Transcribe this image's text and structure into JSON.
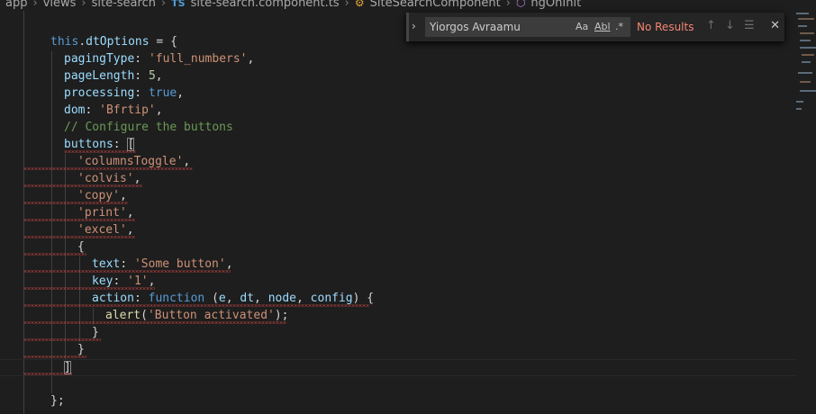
{
  "breadcrumb": {
    "items": [
      "app",
      "views",
      "site-search",
      "site-search.component.ts",
      "SiteSearchComponent",
      "ngOnInit"
    ],
    "ts_badge": "TS"
  },
  "find": {
    "query": "Yiorgos Avraamu",
    "match_case_label": "Aa",
    "whole_word_label": "Abl",
    "regex_label": ".*",
    "status": "No Results"
  },
  "code": {
    "l1_obj": "this",
    "l1_prop": "dtOptions",
    "paging_key": "pagingType",
    "paging_val": "'full_numbers'",
    "length_key": "pageLength",
    "length_val": "5",
    "processing_key": "processing",
    "processing_val": "true",
    "dom_key": "dom",
    "dom_val": "'Bfrtip'",
    "comment": "// Configure the buttons",
    "buttons_key": "buttons",
    "btn1": "'columnsToggle'",
    "btn2": "'colvis'",
    "btn3": "'copy'",
    "btn4": "'print'",
    "btn5": "'excel'",
    "text_key": "text",
    "text_val": "'Some button'",
    "key_key": "key",
    "key_val": "'1'",
    "action_key": "action",
    "function_kw": "function",
    "param_e": "e",
    "param_dt": "dt",
    "param_node": "node",
    "param_config": "config",
    "alert_fn": "alert",
    "alert_arg": "'Button activated'"
  }
}
